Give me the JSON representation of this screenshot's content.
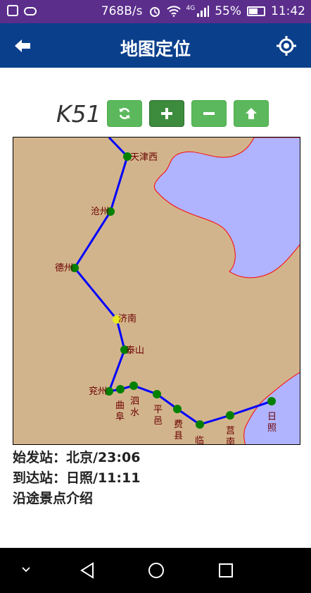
{
  "status_bar": {
    "net_speed": "768B/s",
    "network_type": "4G",
    "battery_percent": "55%",
    "time": "11:42"
  },
  "app_bar": {
    "title": "地图定位",
    "back_icon": "arrow-left-icon",
    "locate_icon": "crosshair-icon"
  },
  "controls": {
    "train_number": "K51",
    "buttons": [
      {
        "name": "refresh",
        "icon": "refresh-icon"
      },
      {
        "name": "zoom-in",
        "icon": "plus-icon"
      },
      {
        "name": "zoom-out",
        "icon": "minus-icon"
      },
      {
        "name": "up",
        "icon": "arrow-up-icon"
      }
    ]
  },
  "map": {
    "colors": {
      "land": "#d2b48c",
      "sea": "#b0b4ff",
      "coast": "#ff0000",
      "route": "#0000ff",
      "station": "#008000",
      "current_station": "#e8e820",
      "label": "#6b0000"
    },
    "stations": [
      "天津西",
      "沧州",
      "德州",
      "济南",
      "泰山",
      "兖州",
      "曲阜",
      "泗水",
      "平邑",
      "费县",
      "临沂",
      "莒南",
      "日照"
    ],
    "current_station": "济南"
  },
  "info": {
    "departure": "始发站：北京/23:06",
    "arrival": "到达站：日照/11:11",
    "attractions": "沿途景点介绍"
  }
}
